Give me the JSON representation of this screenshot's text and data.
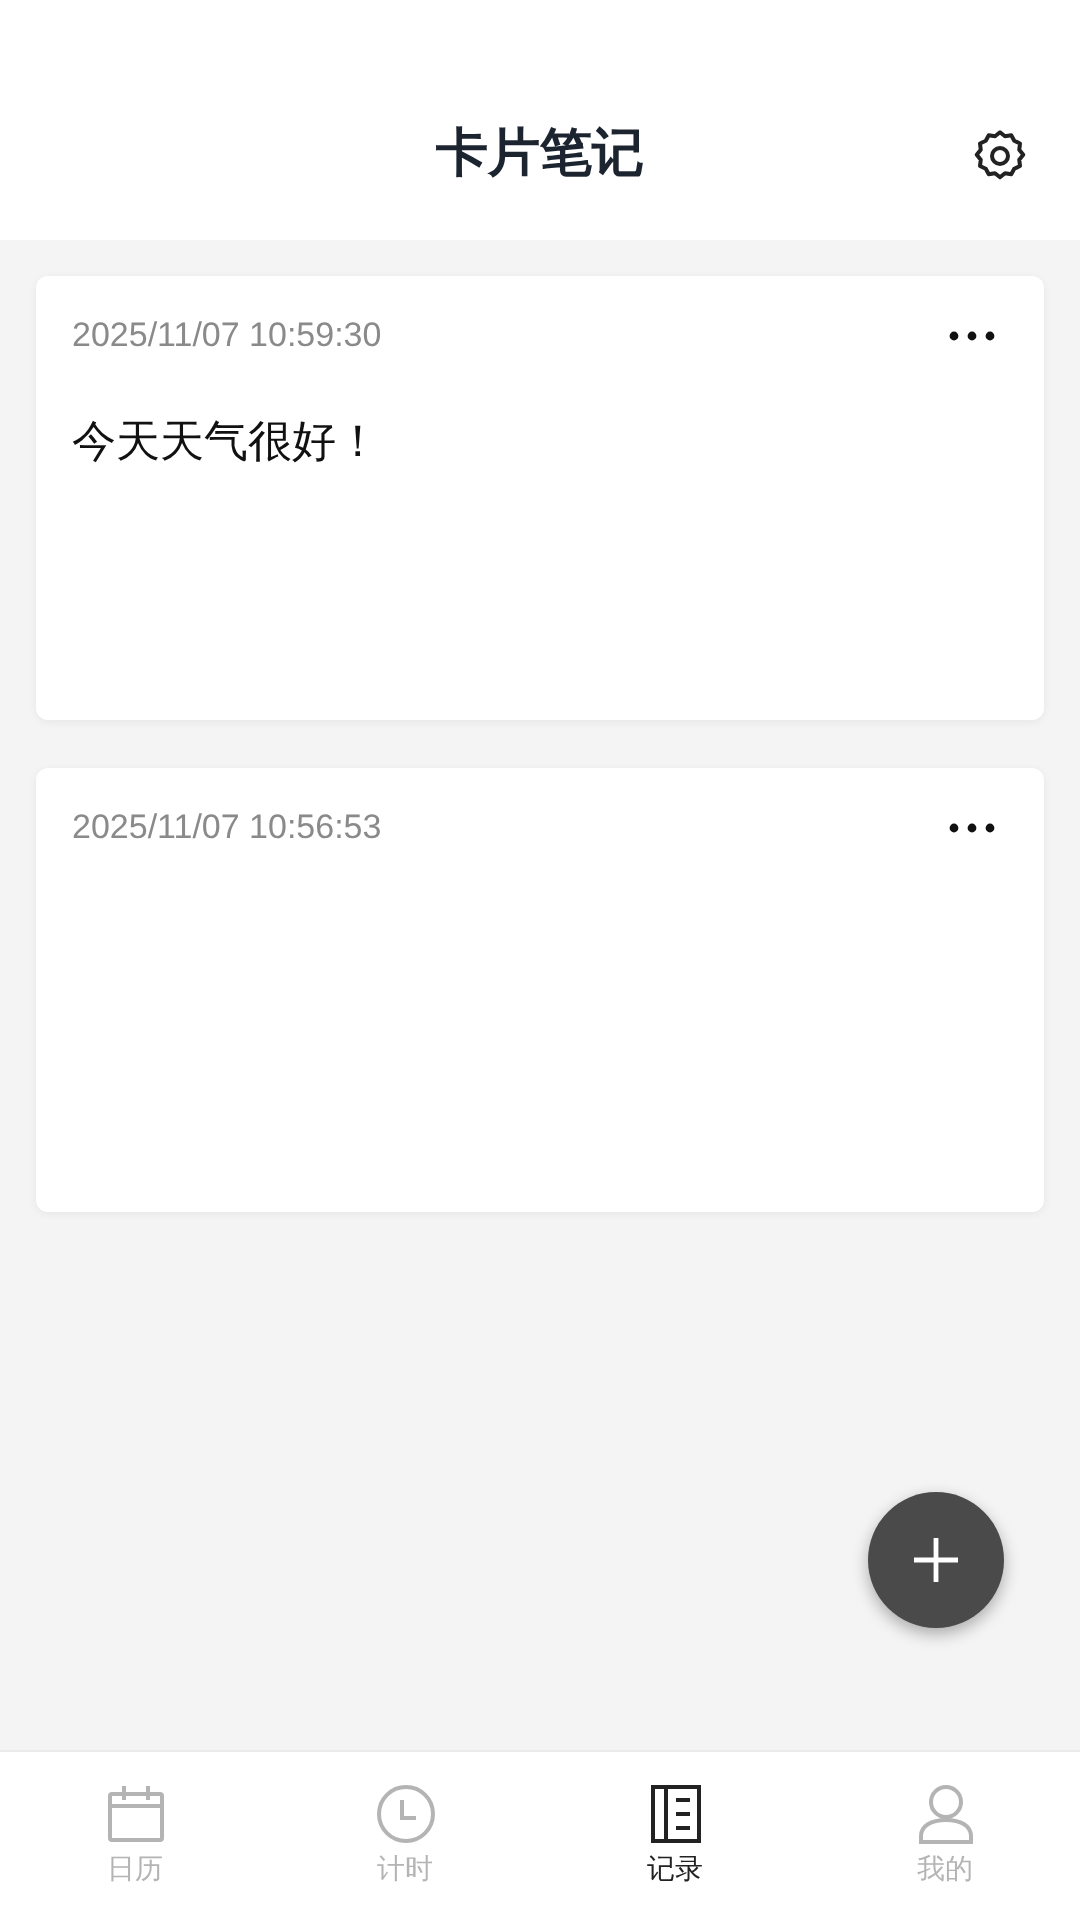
{
  "header": {
    "title": "卡片笔记"
  },
  "notes": [
    {
      "time": "2025/11/07 10:59:30",
      "text": "今天天气很好！"
    },
    {
      "time": "2025/11/07 10:56:53"
    }
  ],
  "tabs": [
    {
      "label": "日历",
      "selected": false
    },
    {
      "label": "计时",
      "selected": false
    },
    {
      "label": "记录",
      "selected": true
    },
    {
      "label": "我的",
      "selected": false
    }
  ]
}
